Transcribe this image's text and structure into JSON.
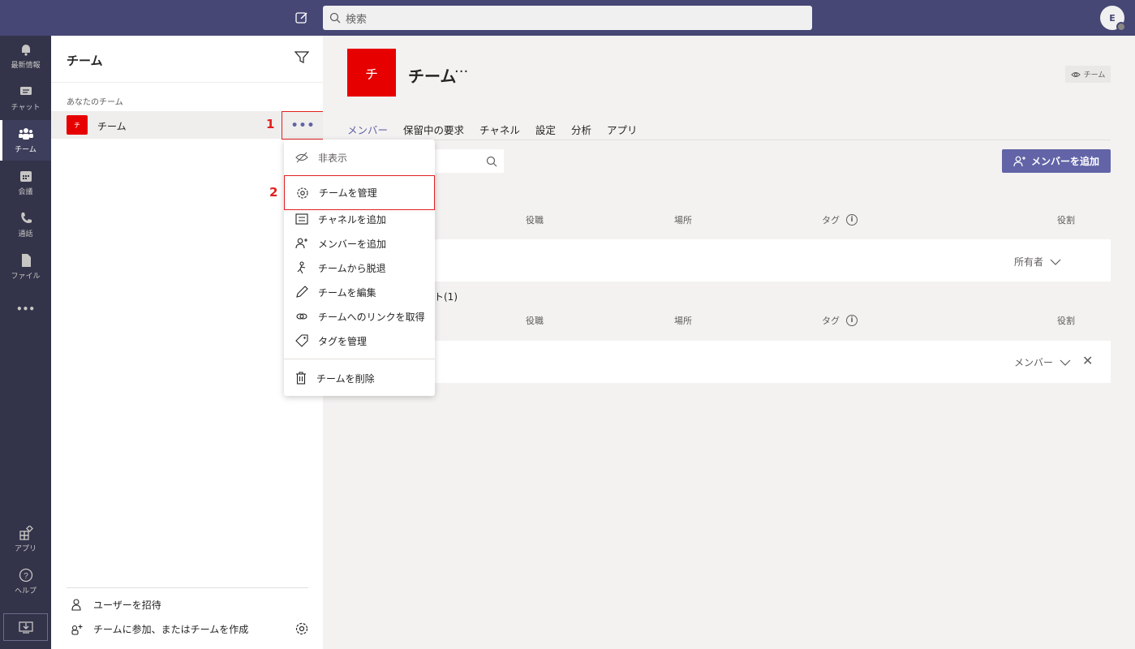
{
  "topbar": {
    "search_placeholder": "検索",
    "avatar_initial": "E"
  },
  "rail": {
    "items": [
      {
        "label": "最新情報",
        "icon": "bell-icon"
      },
      {
        "label": "チャット",
        "icon": "chat-icon"
      },
      {
        "label": "チーム",
        "icon": "teams-icon",
        "active": true
      },
      {
        "label": "会議",
        "icon": "calendar-icon"
      },
      {
        "label": "通話",
        "icon": "phone-icon"
      },
      {
        "label": "ファイル",
        "icon": "file-icon"
      },
      {
        "label": "•••",
        "icon": "more-icon"
      }
    ],
    "apps_label": "アプリ",
    "help_label": "ヘルプ"
  },
  "panel": {
    "title": "チーム",
    "section_label": "あなたのチーム",
    "team": {
      "icon_text": "チ",
      "name": "チーム"
    },
    "more_label": "•••",
    "callout_1": "1",
    "callout_2": "2",
    "footer": {
      "invite": "ユーザーを招待",
      "join_create": "チームに参加、またはチームを作成"
    }
  },
  "menu": {
    "items": [
      {
        "label": "非表示",
        "icon": "hide-icon"
      },
      {
        "label": "チームを管理",
        "icon": "gear-icon"
      },
      {
        "label": "チャネルを追加",
        "icon": "channel-icon"
      },
      {
        "label": "メンバーを追加",
        "icon": "add-person-icon"
      },
      {
        "label": "チームから脱退",
        "icon": "leave-icon"
      },
      {
        "label": "チームを編集",
        "icon": "pencil-icon"
      },
      {
        "label": "チームへのリンクを取得",
        "icon": "link-icon"
      },
      {
        "label": "タグを管理",
        "icon": "tag-icon"
      },
      {
        "label": "チームを削除",
        "icon": "trash-icon"
      }
    ]
  },
  "main": {
    "team_icon_text": "チ",
    "title": "チーム",
    "title_more": "···",
    "visibility_badge": "チーム",
    "tabs": [
      "メンバー",
      "保留中の要求",
      "チャネル",
      "設定",
      "分析",
      "アプリ"
    ],
    "add_member_button": "メンバーを追加",
    "columns": {
      "title": "役職",
      "location": "場所",
      "tags": "タグ",
      "role": "役割"
    },
    "info_glyph": "i",
    "owners_row": {
      "role": "所有者"
    },
    "members_section": "ト(1)",
    "members_row": {
      "role": "メンバー"
    },
    "remove_glyph": "✕"
  }
}
